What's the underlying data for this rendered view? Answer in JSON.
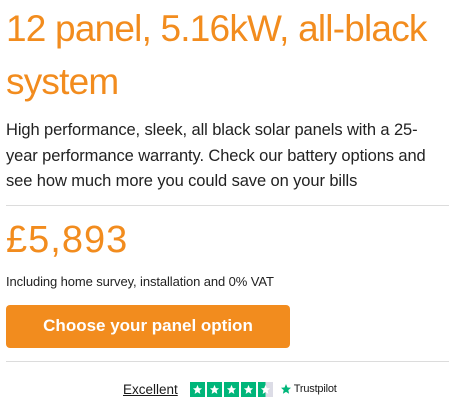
{
  "product": {
    "title": "12 panel, 5.16kW, all-black system",
    "description": "High performance, sleek, all black solar panels with a 25-year performance warranty. Check our battery options and see how much more you could save on your bills",
    "price": "£5,893",
    "price_note": "Including home survey, installation and 0% VAT",
    "cta_label": "Choose your panel option"
  },
  "trustpilot": {
    "rating_label": "Excellent",
    "stars": 4.5,
    "brand": "Trustpilot"
  },
  "colors": {
    "accent": "#f28c1e",
    "trustpilot_green": "#00b67a"
  },
  "icons": {
    "rating_star": "star-icon",
    "brand_logo": "trustpilot-star-icon"
  }
}
